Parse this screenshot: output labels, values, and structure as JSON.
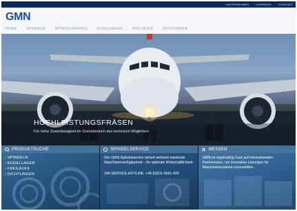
{
  "topbar": {
    "links": [
      "UNTERNEHMEN",
      "KARRIERE",
      "KONTAKT"
    ]
  },
  "header": {
    "logo": "GMN",
    "nav": [
      "HOME",
      "SPINDELN",
      "SPINDELSERVICE",
      "KUGELLAGER",
      "FREILÄUFE",
      "DICHTUNGEN"
    ]
  },
  "hero": {
    "title": "HOCHLEISTUNGSFRÄSEN",
    "subtitle": "Für hohe Zuverlässigkeit im Grenzbereich des technisch Möglichen"
  },
  "panels": {
    "produktsuche": {
      "title": "PRODUKTSUCHE",
      "icon": "search-icon",
      "links": [
        "SPINDELN",
        "KUGELLAGER",
        "FREILÄUFE",
        "DICHTUNGEN"
      ]
    },
    "spindelservice": {
      "title": "SPINDELSERVICE",
      "icon": "gear-icon",
      "text": "Der GMN Spindelservice sichert weltweit maximale Maschinenverfügbarkeit – für optimale Wirtschaftlichkeit.",
      "hotline": "24h SERVICE-HOTLINE: +49 (0)911-5691-600"
    },
    "messen": {
      "title": "MESSEN",
      "icon": "cross-icon",
      "text": "GMN ist regelmäßig Gast auf internationalen Fachmessen, um innovative Lösungen für Maschinensysteme vorzustellen."
    }
  },
  "colors": {
    "brand_blue": "#1e4b9a",
    "topbar": "#0b2a57",
    "panel_head": "#4a749e"
  }
}
